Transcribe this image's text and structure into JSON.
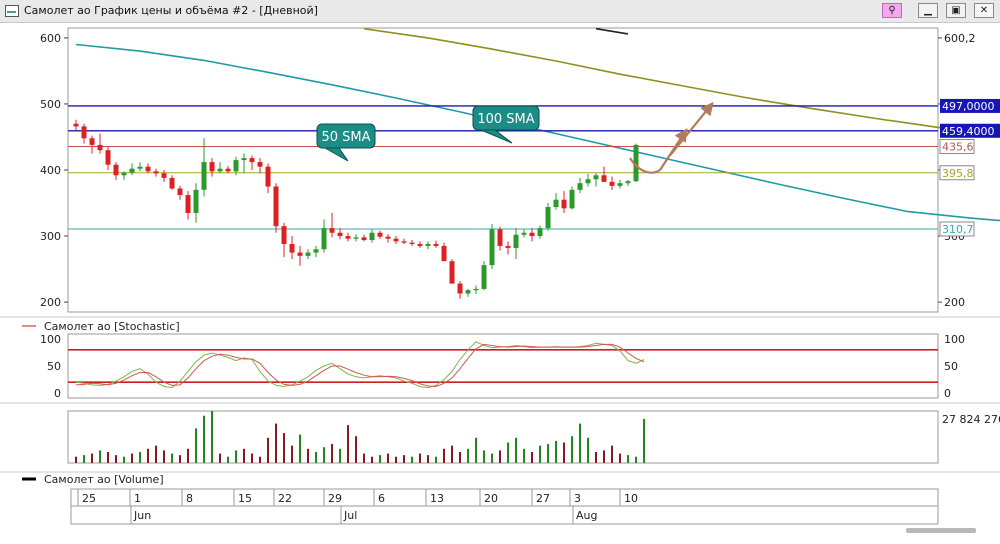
{
  "window": {
    "title": "Самолет ао График цены и объёма #2 - [Дневной]",
    "buttons": {
      "pin_icon": "pin-icon",
      "min": "▁",
      "max": "▣",
      "close": "✕"
    }
  },
  "chart_data": [
    {
      "type": "candlestick",
      "panel": "price",
      "ylim": [
        185,
        615
      ],
      "yticks": [
        200,
        300,
        400,
        500,
        600
      ],
      "right_ticks": [
        "200",
        "300",
        "400",
        "500",
        "600,2"
      ],
      "candles": [
        [
          470,
          476,
          460,
          466
        ],
        [
          466,
          470,
          440,
          448
        ],
        [
          448,
          452,
          425,
          438
        ],
        [
          438,
          455,
          425,
          430
        ],
        [
          430,
          435,
          400,
          408
        ],
        [
          408,
          412,
          385,
          392
        ],
        [
          392,
          398,
          385,
          396
        ],
        [
          396,
          410,
          392,
          402
        ],
        [
          402,
          412,
          398,
          405
        ],
        [
          405,
          410,
          395,
          398
        ],
        [
          398,
          402,
          390,
          395
        ],
        [
          395,
          400,
          382,
          388
        ],
        [
          388,
          392,
          370,
          372
        ],
        [
          372,
          376,
          355,
          362
        ],
        [
          362,
          368,
          325,
          335
        ],
        [
          335,
          380,
          320,
          370
        ],
        [
          370,
          448,
          360,
          412
        ],
        [
          412,
          418,
          390,
          398
        ],
        [
          398,
          412,
          395,
          402
        ],
        [
          402,
          406,
          395,
          398
        ],
        [
          398,
          420,
          392,
          415
        ],
        [
          415,
          425,
          395,
          418
        ],
        [
          418,
          422,
          400,
          412
        ],
        [
          412,
          418,
          395,
          405
        ],
        [
          405,
          410,
          365,
          375
        ],
        [
          375,
          380,
          305,
          315
        ],
        [
          315,
          320,
          268,
          288
        ],
        [
          288,
          300,
          265,
          275
        ],
        [
          275,
          285,
          255,
          270
        ],
        [
          270,
          280,
          265,
          275
        ],
        [
          275,
          285,
          268,
          280
        ],
        [
          280,
          325,
          275,
          312
        ],
        [
          312,
          335,
          298,
          305
        ],
        [
          305,
          312,
          295,
          300
        ],
        [
          300,
          305,
          292,
          296
        ],
        [
          296,
          303,
          292,
          298
        ],
        [
          298,
          302,
          292,
          294
        ],
        [
          294,
          310,
          290,
          305
        ],
        [
          305,
          308,
          296,
          299
        ],
        [
          299,
          303,
          290,
          296
        ],
        [
          296,
          300,
          288,
          292
        ],
        [
          292,
          296,
          288,
          290
        ],
        [
          290,
          294,
          285,
          288
        ],
        [
          288,
          292,
          282,
          285
        ],
        [
          285,
          292,
          280,
          288
        ],
        [
          288,
          293,
          282,
          285
        ],
        [
          285,
          290,
          262,
          262
        ],
        [
          262,
          265,
          230,
          228
        ],
        [
          228,
          232,
          205,
          213
        ],
        [
          213,
          220,
          208,
          218
        ],
        [
          218,
          225,
          212,
          220
        ],
        [
          220,
          262,
          218,
          256
        ],
        [
          256,
          318,
          250,
          310
        ],
        [
          310,
          314,
          278,
          285
        ],
        [
          285,
          292,
          272,
          282
        ],
        [
          282,
          312,
          265,
          302
        ],
        [
          302,
          310,
          298,
          305
        ],
        [
          305,
          312,
          292,
          300
        ],
        [
          300,
          316,
          296,
          312
        ],
        [
          312,
          350,
          308,
          344
        ],
        [
          344,
          365,
          340,
          355
        ],
        [
          355,
          368,
          335,
          342
        ],
        [
          342,
          375,
          340,
          370
        ],
        [
          370,
          388,
          365,
          380
        ],
        [
          380,
          394,
          375,
          386
        ],
        [
          386,
          395,
          375,
          392
        ],
        [
          392,
          405,
          385,
          382
        ],
        [
          382,
          390,
          370,
          376
        ],
        [
          376,
          385,
          372,
          380
        ],
        [
          380,
          385,
          376,
          383
        ],
        [
          383,
          440,
          382,
          438
        ]
      ],
      "moving_averages": [
        {
          "name": "50 SMA",
          "color": "#1f9aa6",
          "points": [
            [
              0,
              590
            ],
            [
              8,
              580
            ],
            [
              16,
              566
            ],
            [
              24,
              548
            ],
            [
              32,
              529
            ],
            [
              40,
              509
            ],
            [
              48,
              488
            ],
            [
              56,
              466
            ],
            [
              64,
              444
            ],
            [
              72,
              422
            ],
            [
              80,
              400
            ],
            [
              88,
              378
            ],
            [
              96,
              357
            ],
            [
              104,
              337
            ],
            [
              112,
              327
            ],
            [
              120,
              319
            ],
            [
              128,
              315
            ],
            [
              136,
              312
            ],
            [
              144,
              311
            ]
          ]
        },
        {
          "name": "100 SMA",
          "color": "#8f8f1c",
          "points": [
            [
              36,
              614
            ],
            [
              44,
              600
            ],
            [
              52,
              583
            ],
            [
              60,
              565
            ],
            [
              68,
              545
            ],
            [
              76,
              527
            ],
            [
              84,
              509
            ],
            [
              92,
              493
            ],
            [
              100,
              478
            ],
            [
              108,
              464
            ],
            [
              116,
              450
            ],
            [
              124,
              437
            ],
            [
              132,
              426
            ],
            [
              140,
              414
            ],
            [
              144,
              402
            ]
          ]
        }
      ],
      "hlines": [
        {
          "value": 497.0,
          "label": "497,0000",
          "color": "#1a1aa8",
          "badge": true
        },
        {
          "value": 459.4,
          "label": "459,4000",
          "color": "#1a1aa8",
          "badge": true
        },
        {
          "value": 435.6,
          "label": "435,6",
          "color": "#c25050",
          "badge": false
        },
        {
          "value": 395.8,
          "label": "395,8",
          "color": "#a6a628",
          "badge": false
        },
        {
          "value": 310.7,
          "label": "310,7",
          "color": "#3aa8ac",
          "badge": false
        }
      ],
      "annotations": [
        "50 SMA",
        "100 SMA"
      ],
      "projection_color": "#b27b5b"
    },
    {
      "type": "line",
      "panel": "stochastic",
      "legend": "Самолет ао [Stochastic]",
      "ylim": [
        0,
        100
      ],
      "yticks": [
        0,
        50,
        100
      ],
      "right_ticks": [
        "0",
        "50",
        "100"
      ],
      "levels": [
        80,
        20
      ],
      "series": [
        {
          "color": "#7ab84a",
          "values": [
            20,
            18,
            15,
            14,
            16,
            22,
            30,
            40,
            45,
            35,
            20,
            12,
            10,
            22,
            40,
            58,
            70,
            74,
            70,
            66,
            60,
            65,
            62,
            40,
            22,
            14,
            12,
            15,
            22,
            30,
            42,
            50,
            55,
            45,
            35,
            30,
            28,
            30,
            32,
            30,
            28,
            22,
            18,
            12,
            10,
            14,
            25,
            40,
            62,
            80,
            95,
            88,
            84,
            85,
            86,
            88,
            86,
            84,
            85,
            85,
            86,
            85,
            85,
            86,
            88,
            92,
            90,
            88,
            78,
            60,
            55,
            62
          ]
        },
        {
          "color": "#d65656",
          "values": [
            15,
            16,
            18,
            17,
            15,
            18,
            24,
            32,
            38,
            38,
            30,
            20,
            14,
            15,
            28,
            45,
            60,
            68,
            72,
            70,
            66,
            63,
            63,
            55,
            38,
            24,
            16,
            14,
            16,
            22,
            32,
            42,
            50,
            50,
            44,
            38,
            33,
            30,
            30,
            31,
            30,
            27,
            23,
            17,
            13,
            12,
            18,
            28,
            45,
            64,
            82,
            90,
            88,
            86,
            85,
            86,
            87,
            86,
            85,
            85,
            85,
            85,
            85,
            85,
            86,
            88,
            90,
            90,
            85,
            74,
            64,
            58
          ]
        }
      ]
    },
    {
      "type": "bar",
      "panel": "volume",
      "legend": "Самолет ао [Volume]",
      "last_label": "27 824 276",
      "values": [
        4,
        5,
        6,
        8,
        7,
        5,
        4,
        6,
        7,
        9,
        11,
        8,
        6,
        5,
        9,
        22,
        30,
        33,
        6,
        4,
        8,
        9,
        6,
        4,
        16,
        25,
        19,
        11,
        18,
        9,
        7,
        10,
        12,
        9,
        24,
        17,
        6,
        4,
        5,
        6,
        4,
        5,
        4,
        6,
        5,
        4,
        9,
        11,
        7,
        9,
        16,
        8,
        6,
        8,
        13,
        16,
        9,
        7,
        11,
        12,
        14,
        13,
        17,
        25,
        16,
        7,
        8,
        11,
        6,
        5,
        4,
        28
      ],
      "up": [
        0,
        1,
        0,
        1,
        0,
        0,
        1,
        0,
        1,
        0,
        0,
        0,
        1,
        0,
        0,
        1,
        1,
        1,
        0,
        1,
        1,
        0,
        0,
        0,
        0,
        0,
        0,
        0,
        1,
        0,
        1,
        1,
        0,
        1,
        0,
        0,
        0,
        0,
        1,
        0,
        0,
        0,
        1,
        0,
        0,
        1,
        0,
        0,
        0,
        1,
        1,
        1,
        1,
        0,
        1,
        1,
        1,
        0,
        1,
        1,
        1,
        0,
        1,
        1,
        1,
        0,
        0,
        0,
        0,
        1,
        1,
        1
      ]
    }
  ],
  "xaxis": {
    "days": [
      "25",
      "1",
      "8",
      "15",
      "22",
      "29",
      "6",
      "13",
      "20",
      "27",
      "3",
      "10"
    ],
    "months": [
      "Jun",
      "Jul",
      "Aug"
    ]
  }
}
